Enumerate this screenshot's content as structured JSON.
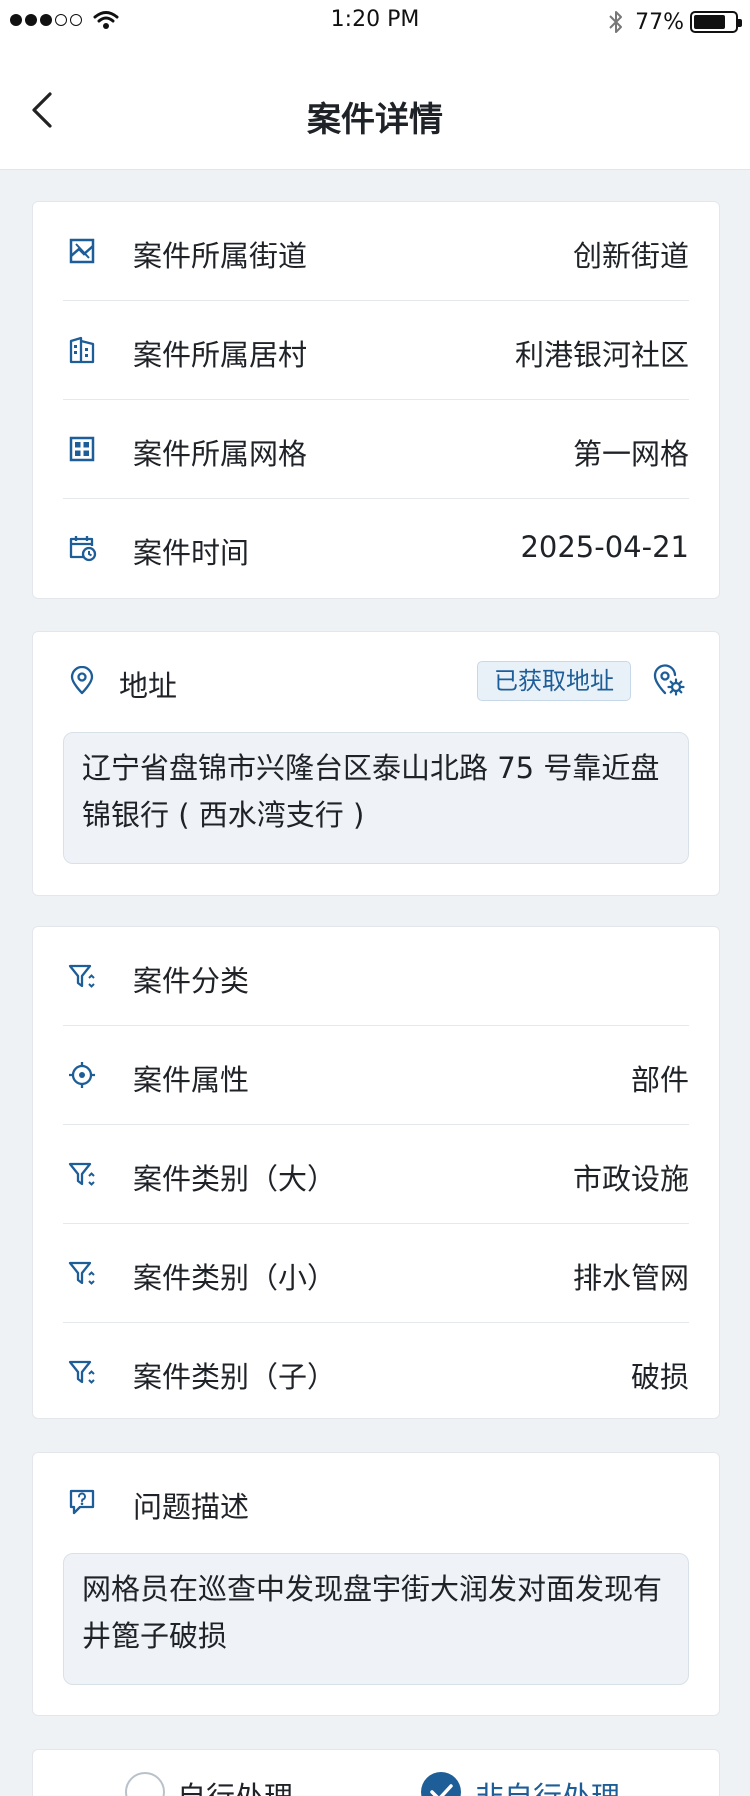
{
  "status_bar": {
    "time": "1:20 PM",
    "battery_percent": "77%",
    "battery_level": 0.77,
    "signal_bars_filled": 3,
    "signal_bars_total": 5
  },
  "header": {
    "title": "案件详情"
  },
  "location_card": {
    "rows": [
      {
        "icon": "map-image-icon",
        "label": "案件所属街道",
        "value": "创新街道"
      },
      {
        "icon": "building-icon",
        "label": "案件所属居村",
        "value": "利港银河社区"
      },
      {
        "icon": "grid-icon",
        "label": "案件所属网格",
        "value": "第一网格"
      },
      {
        "icon": "calendar-clock-icon",
        "label": "案件时间",
        "value": "2025-04-21"
      }
    ]
  },
  "address_card": {
    "label": "地址",
    "badge": "已获取地址",
    "address": "辽宁省盘锦市兴隆台区泰山北路 75 号靠近盘锦银行 ( 西水湾支行 )"
  },
  "category_card": {
    "title": "案件分类",
    "rows": [
      {
        "icon": "crosshair-icon",
        "label": "案件属性",
        "value": "部件"
      },
      {
        "icon": "filter-sort-icon",
        "label": "案件类别（大）",
        "value": "市政设施"
      },
      {
        "icon": "filter-sort-icon",
        "label": "案件类别（小）",
        "value": "排水管网"
      },
      {
        "icon": "filter-sort-icon",
        "label": "案件类别（子）",
        "value": "破损"
      }
    ]
  },
  "description_card": {
    "title": "问题描述",
    "text": "网格员在巡查中发现盘宇街大润发对面发现有井篦子破损"
  },
  "handling_card": {
    "options": [
      {
        "label": "自行处理",
        "selected": false
      },
      {
        "label": "非自行处理",
        "selected": true
      }
    ]
  },
  "colors": {
    "accent": "#1d5d98",
    "background": "#eef2f5",
    "card": "#ffffff",
    "text_box": "#eff3f7"
  }
}
